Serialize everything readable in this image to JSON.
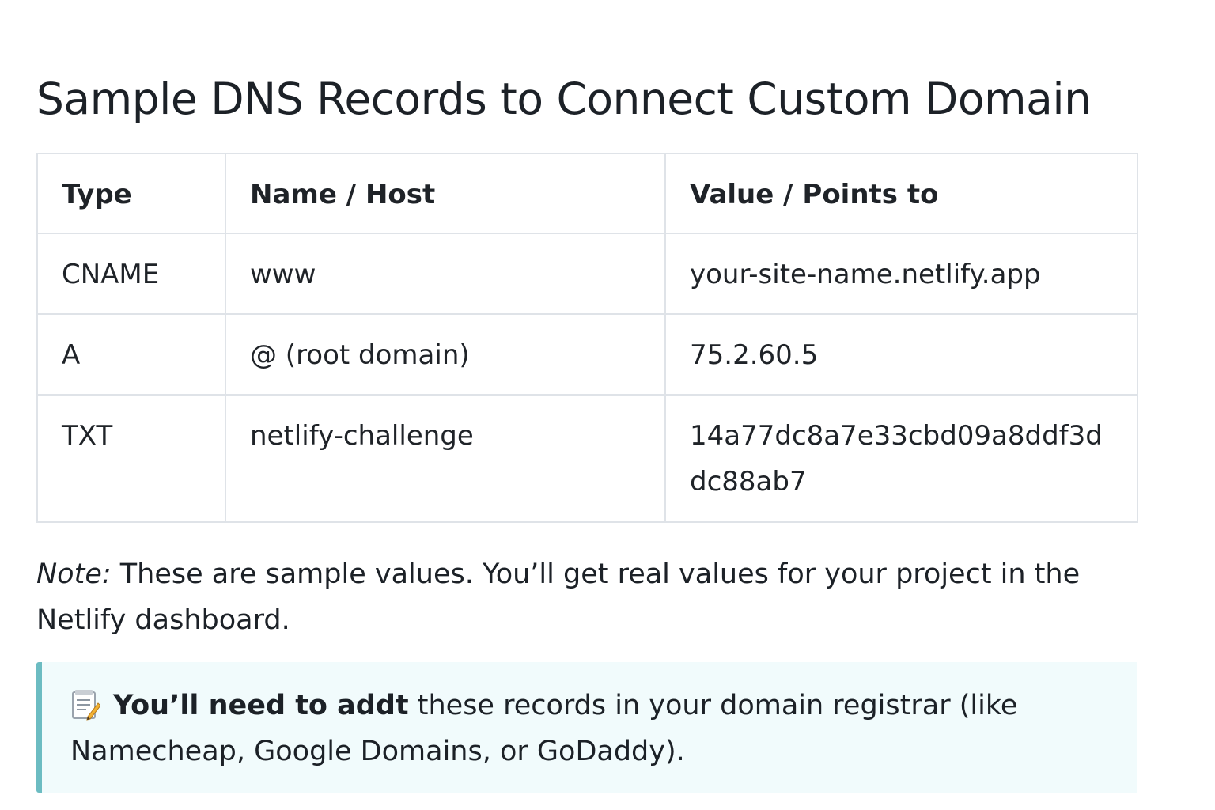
{
  "title": "Sample DNS Records to Connect Custom Domain",
  "table": {
    "headers": [
      "Type",
      "Name / Host",
      "Value / Points to"
    ],
    "rows": [
      {
        "type": "CNAME",
        "name": "www",
        "value": "your-site-name.netlify.app"
      },
      {
        "type": "A",
        "name": "@ (root domain)",
        "value": "75.2.60.5"
      },
      {
        "type": "TXT",
        "name": "netlify-challenge",
        "value": "14a77dc8a7e33cbd09a8ddf3ddc88ab7"
      }
    ]
  },
  "note": {
    "label": "Note:",
    "text": " These are sample values. You’ll get real values for your project in the Netlify dashboard."
  },
  "callout": {
    "icon": "memo-icon",
    "bold": "You’ll need to addt",
    "text": " these records in your domain registrar (like Namecheap, Google Domains, or GoDaddy)."
  },
  "colors": {
    "text": "#1c2127",
    "border": "#dfe3e8",
    "callout_bg": "#f1fbfc",
    "callout_accent": "#6cbcc2"
  }
}
